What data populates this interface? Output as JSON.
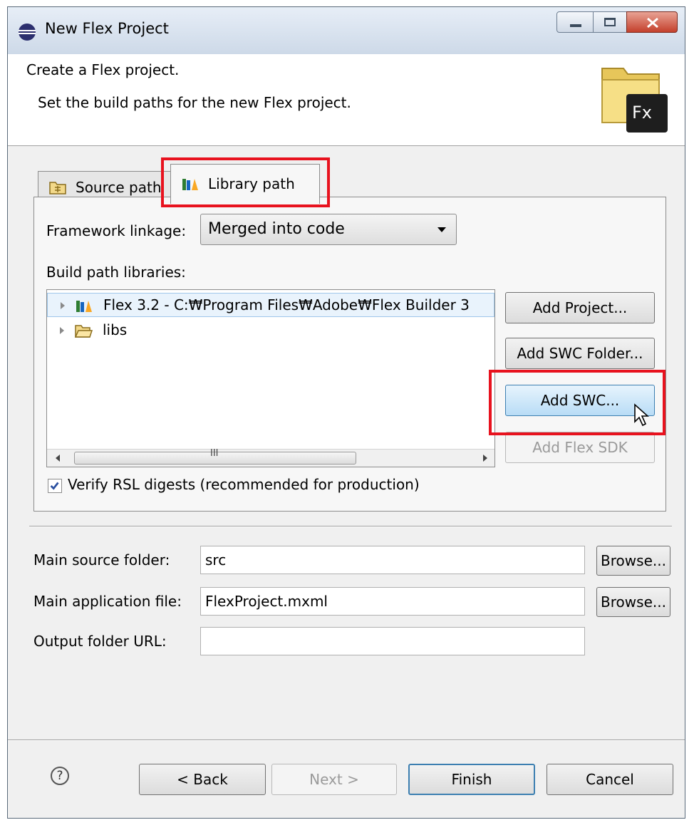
{
  "window": {
    "title": "New Flex Project",
    "header_title": "Create a Flex project.",
    "header_description": "Set the build paths for the new Flex project.",
    "logo_text": "Fx"
  },
  "tabs": [
    {
      "label": "Source path",
      "icon": "source-path-icon",
      "selected": false
    },
    {
      "label": "Library path",
      "icon": "library-path-icon",
      "selected": true
    }
  ],
  "library": {
    "framework_linkage_label": "Framework linkage:",
    "framework_linkage_value": "Merged into code",
    "build_path_label": "Build path libraries:",
    "tree": [
      {
        "label": "Flex 3.2 - C:₩Program Files₩Adobe₩Flex Builder 3",
        "icon": "library-icon",
        "selected": true
      },
      {
        "label": "libs",
        "icon": "folder-icon",
        "selected": false
      }
    ],
    "buttons": {
      "add_project": "Add Project...",
      "add_swc_folder": "Add SWC Folder...",
      "add_swc": "Add SWC...",
      "add_flex_sdk": "Add Flex SDK"
    },
    "verify_rsl_label": "Verify RSL digests (recommended for production)",
    "verify_rsl_checked": true,
    "scroll_grip": "III"
  },
  "fields": {
    "main_source_label": "Main source folder:",
    "main_source_value": "src",
    "main_app_label": "Main application file:",
    "main_app_value": "FlexProject.mxml",
    "output_url_label": "Output folder URL:",
    "output_url_value": "",
    "browse": "Browse..."
  },
  "footer": {
    "help": "?",
    "back": "< Back",
    "next": "Next >",
    "finish": "Finish",
    "cancel": "Cancel"
  },
  "colors": {
    "highlight": "#e8121e",
    "hover_button": "#b8dcf6"
  }
}
